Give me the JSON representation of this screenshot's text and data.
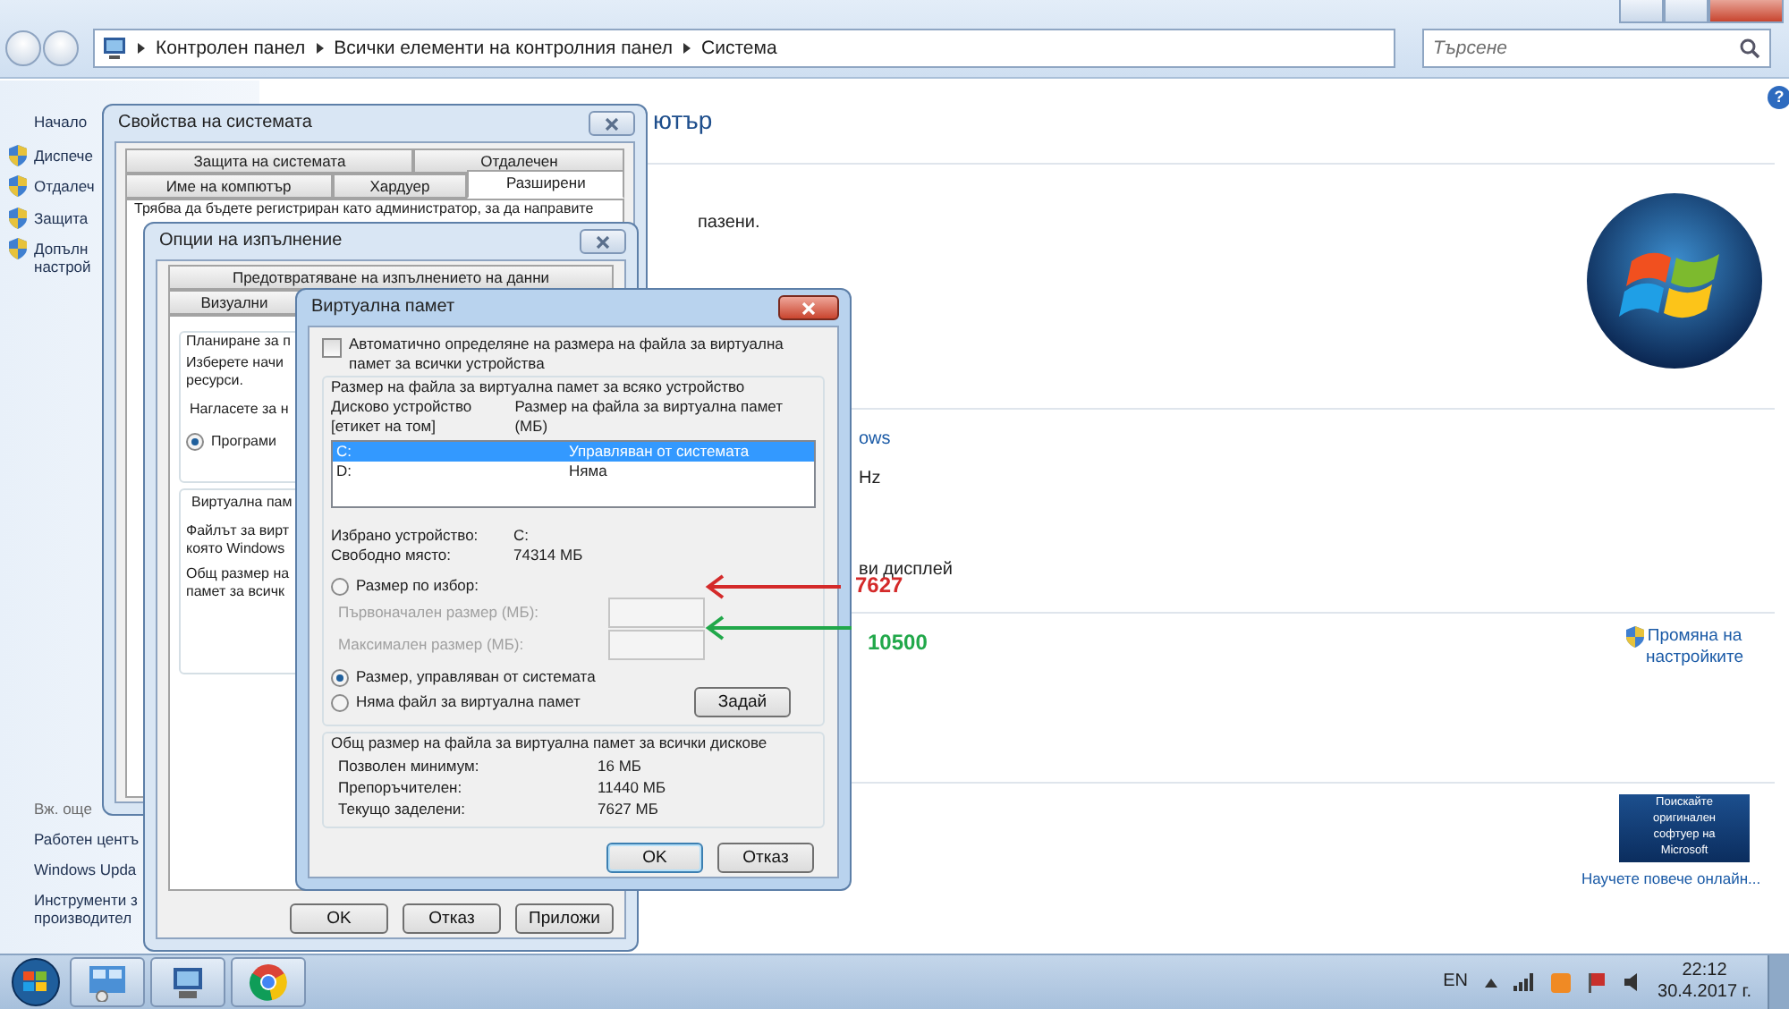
{
  "explorer": {
    "breadcrumb": [
      "Контролен панел",
      "Всички елементи на контролния панел",
      "Система"
    ],
    "search": {
      "placeholder": "Търсене"
    },
    "help": "?",
    "sidebar": {
      "home": "Начало",
      "tasks": [
        {
          "lines": [
            "Диспече"
          ]
        },
        {
          "lines": [
            "Отдалеч"
          ]
        },
        {
          "lines": [
            "Защита"
          ]
        },
        {
          "lines": [
            "Допълн",
            "настрой"
          ]
        }
      ],
      "see_also_heading": "Вж. още",
      "see_also": [
        {
          "lines": [
            "Работен центъ"
          ]
        },
        {
          "lines": [
            "Windows Upda"
          ]
        },
        {
          "lines": [
            "Инструменти з",
            "производител"
          ]
        }
      ]
    },
    "content": {
      "fragments": [
        {
          "kind": "title",
          "text": "ютър"
        },
        {
          "kind": "text",
          "text": "пазени."
        },
        {
          "kind": "link",
          "text": "ows"
        },
        {
          "kind": "text",
          "text": "Hz"
        },
        {
          "kind": "text",
          "text": "ви дисплей"
        }
      ],
      "change_settings": [
        "Промяна на",
        "настройките"
      ],
      "genuine_badge": [
        "Поискайте",
        "оригинален",
        "софтуер на",
        "Microsoft"
      ],
      "learn_more": "Научете повече онлайн..."
    }
  },
  "annotations": [
    {
      "text": "7627",
      "color": "#d42a2a"
    },
    {
      "text": "10500",
      "color": "#21a84a"
    }
  ],
  "system_properties": {
    "title": "Свойства на системата",
    "tabs_row1": [
      {
        "label": "Защита на системата",
        "selected": false
      },
      {
        "label": "Отдалечен",
        "selected": false
      }
    ],
    "tabs_row2": [
      {
        "label": "Име на компютър",
        "selected": false
      },
      {
        "label": "Хардуер",
        "selected": false
      },
      {
        "label": "Разширени",
        "selected": true
      }
    ],
    "notice": "Трябва да бъдете регистриран като администратор, за да направите"
  },
  "performance_options": {
    "title": "Опции на изпълнение",
    "tabs_row1": [
      {
        "label": "Предотвратяване на изпълнението на данни",
        "selected": false
      }
    ],
    "tabs_row2": [
      {
        "label": "Визуални",
        "selected": false
      }
    ],
    "scheduling": {
      "legend": "Планиране за п",
      "lines": [
        "Изберете начи",
        "ресурси."
      ],
      "adjust": "Нагласете за н",
      "radio": {
        "label": "Програми",
        "checked": true
      }
    },
    "virtual_memory": {
      "legend": "Виртуална пам",
      "paragraphs": [
        [
          "Файлът за вирт",
          "която Windows"
        ],
        [
          "Общ размер на",
          "памет за всичк"
        ]
      ]
    },
    "buttons": [
      "OK",
      "Отказ",
      "Приложи"
    ]
  },
  "virtual_memory": {
    "title": "Виртуална памет",
    "auto_manage": {
      "label": "Автоматично определяне на размера на файла за виртуална памет за всички устройства",
      "checked": false
    },
    "per_drive_legend": "Размер на файла за виртуална памет за всяко устройство",
    "columns": [
      "Дисково устройство [етикет на том]",
      "Размер на файла за виртуална памет (МБ)"
    ],
    "drives": [
      {
        "drive": "C:",
        "size": "Управляван от системата",
        "selected": true
      },
      {
        "drive": "D:",
        "size": "Няма",
        "selected": false
      }
    ],
    "selected_drive_label": "Избрано устройство:",
    "selected_drive": "C:",
    "free_space_label": "Свободно място:",
    "free_space": "74314 МБ",
    "options": [
      {
        "label": "Размер по избор:",
        "checked": false
      },
      {
        "label": "Размер, управляван от системата",
        "checked": true
      },
      {
        "label": "Няма файл за виртуална памет",
        "checked": false
      }
    ],
    "custom_fields": [
      {
        "label": "Първоначален размер (МБ):",
        "disabled": true
      },
      {
        "label": "Максимален размер (МБ):",
        "disabled": true
      }
    ],
    "set_button": "Задай",
    "totals_legend": "Общ размер на файла за виртуална памет за всички дискове",
    "totals": [
      {
        "label": "Позволен минимум:",
        "value": "16 МБ"
      },
      {
        "label": "Препоръчителен:",
        "value": "11440 МБ"
      },
      {
        "label": "Текущо заделени:",
        "value": "7627 МБ"
      }
    ],
    "buttons": [
      {
        "label": "OK",
        "default": true
      },
      {
        "label": "Отказ",
        "default": false
      }
    ]
  },
  "taskbar": {
    "apps": [
      {
        "kind": "control-panel"
      },
      {
        "kind": "computer"
      },
      {
        "kind": "browser"
      }
    ],
    "language": "EN",
    "time": "22:12",
    "date": "30.4.2017 г."
  }
}
